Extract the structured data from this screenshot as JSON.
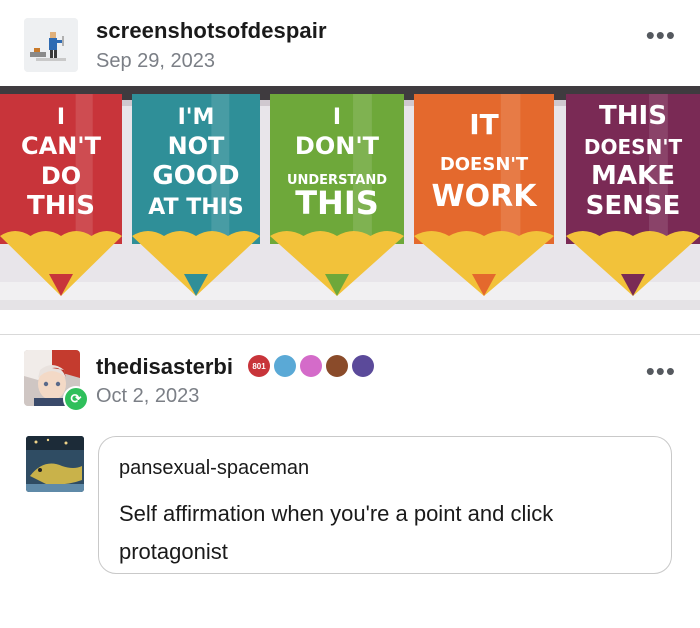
{
  "post": {
    "username": "screenshotsofdespair",
    "date": "Sep 29, 2023",
    "more_label": "•••"
  },
  "photo": {
    "banners": [
      {
        "lines": [
          "I",
          "CAN'T",
          "DO",
          "THIS"
        ],
        "color": "#c8343a"
      },
      {
        "lines": [
          "I'M",
          "NOT",
          "GOOD",
          "AT THIS"
        ],
        "color": "#2f8f98"
      },
      {
        "lines": [
          "I",
          "DON'T",
          "UNDERSTAND",
          "THIS"
        ],
        "color": "#6ea83a"
      },
      {
        "lines": [
          "IT",
          "DOESN'T",
          "WORK"
        ],
        "color": "#e4692d"
      },
      {
        "lines": [
          "THIS",
          "DOESN'T",
          "MAKE",
          "SENSE"
        ],
        "color": "#7a2a55"
      }
    ],
    "pencil_tip_color": "#f2c23a"
  },
  "reblog": {
    "username": "thedisasterbi",
    "date": "Oct 2, 2023",
    "more_label": "•••",
    "badges": [
      {
        "icon": "badge-red-hex",
        "color": "#c8343a",
        "text": "801"
      },
      {
        "icon": "robot-icon",
        "color": "#5aa9d6",
        "text": ""
      },
      {
        "icon": "paw-pink-icon",
        "color": "#d46bc9",
        "text": ""
      },
      {
        "icon": "paw-brown-icon",
        "color": "#8a4b2a",
        "text": ""
      },
      {
        "icon": "paw-purple-icon",
        "color": "#5b4a9a",
        "text": ""
      }
    ],
    "badge_symbol": "⟳"
  },
  "quote": {
    "username": "pansexual-spaceman",
    "text": "Self affirmation when you're a point and click protagonist"
  }
}
